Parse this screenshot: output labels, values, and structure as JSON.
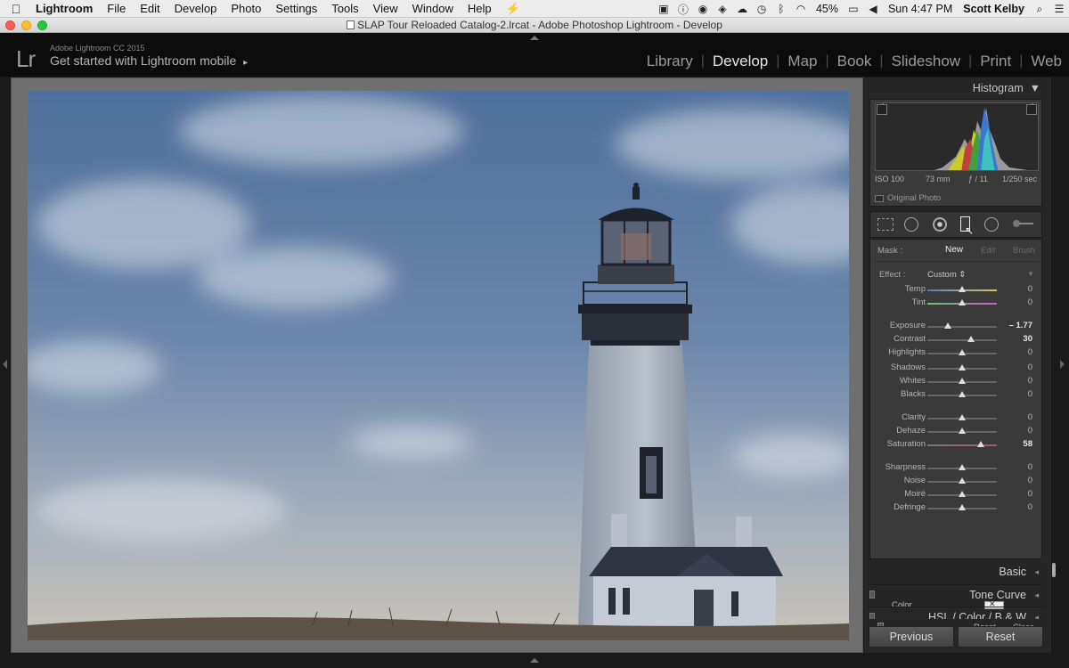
{
  "menubar": {
    "apple": "",
    "items": [
      "Lightroom",
      "File",
      "Edit",
      "Develop",
      "Photo",
      "Settings",
      "Tools",
      "View",
      "Window",
      "Help"
    ],
    "battery": "45%",
    "clock": "Sun 4:47 PM",
    "user": "Scott Kelby"
  },
  "window": {
    "title": "SLAP Tour Reloaded Catalog-2.lrcat - Adobe Photoshop Lightroom - Develop"
  },
  "identity": {
    "logo": "Lr",
    "product": "Adobe Lightroom CC 2015",
    "promo": "Get started with Lightroom mobile",
    "promo_arrow": "▸"
  },
  "modules": [
    "Library",
    "Develop",
    "Map",
    "Book",
    "Slideshow",
    "Print",
    "Web"
  ],
  "histogram": {
    "title": "Histogram",
    "iso": "ISO 100",
    "focal": "73 mm",
    "aperture": "ƒ / 11",
    "shutter": "1/250 sec",
    "original_photo": "Original Photo"
  },
  "mask": {
    "label": "Mask :",
    "new": "New",
    "edit": "Edit",
    "brush": "Brush",
    "effect_label": "Effect :",
    "effect_value": "Custom ⇕",
    "sliders": [
      {
        "label": "Temp",
        "value": "0",
        "pos": 0.5
      },
      {
        "label": "Tint",
        "value": "0",
        "pos": 0.5
      },
      {
        "label": "Exposure",
        "value": "– 1.77",
        "pos": 0.3,
        "bold": true
      },
      {
        "label": "Contrast",
        "value": "30",
        "pos": 0.63,
        "bold": true
      },
      {
        "label": "Highlights",
        "value": "0",
        "pos": 0.5
      },
      {
        "label": "Shadows",
        "value": "0",
        "pos": 0.5
      },
      {
        "label": "Whites",
        "value": "0",
        "pos": 0.5
      },
      {
        "label": "Blacks",
        "value": "0",
        "pos": 0.5
      },
      {
        "label": "Clarity",
        "value": "0",
        "pos": 0.5
      },
      {
        "label": "Dehaze",
        "value": "0",
        "pos": 0.5
      },
      {
        "label": "Saturation",
        "value": "58",
        "pos": 0.77,
        "bold": true
      },
      {
        "label": "Sharpness",
        "value": "0",
        "pos": 0.5
      },
      {
        "label": "Noise",
        "value": "0",
        "pos": 0.5
      },
      {
        "label": "Moiré",
        "value": "0",
        "pos": 0.5
      },
      {
        "label": "Defringe",
        "value": "0",
        "pos": 0.5
      }
    ],
    "color_label": "Color",
    "reset": "Reset",
    "close": "Close"
  },
  "panels": [
    "Basic",
    "Tone Curve",
    "HSL / Color / B & W"
  ],
  "buttons": {
    "previous": "Previous",
    "reset": "Reset"
  }
}
